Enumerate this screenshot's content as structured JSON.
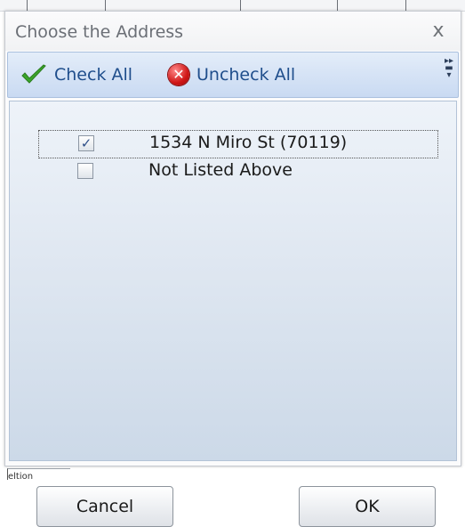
{
  "dialog": {
    "title": "Choose the Address",
    "close_glyph": "x"
  },
  "toolbar": {
    "check_all_label": "Check All",
    "uncheck_all_label": "Uncheck All"
  },
  "address_list": {
    "items": [
      {
        "label": "1534 N Miro St (70119)",
        "checked": true
      },
      {
        "label": "Not Listed Above",
        "checked": false
      }
    ]
  },
  "buttons": {
    "cancel_label": "Cancel",
    "ok_label": "OK"
  },
  "background": {
    "bottom_fragment": "eltion"
  },
  "colors": {
    "toolbar_text": "#1f4e8c",
    "check_icon": "#3aa52a",
    "uncheck_icon": "#d01616"
  }
}
